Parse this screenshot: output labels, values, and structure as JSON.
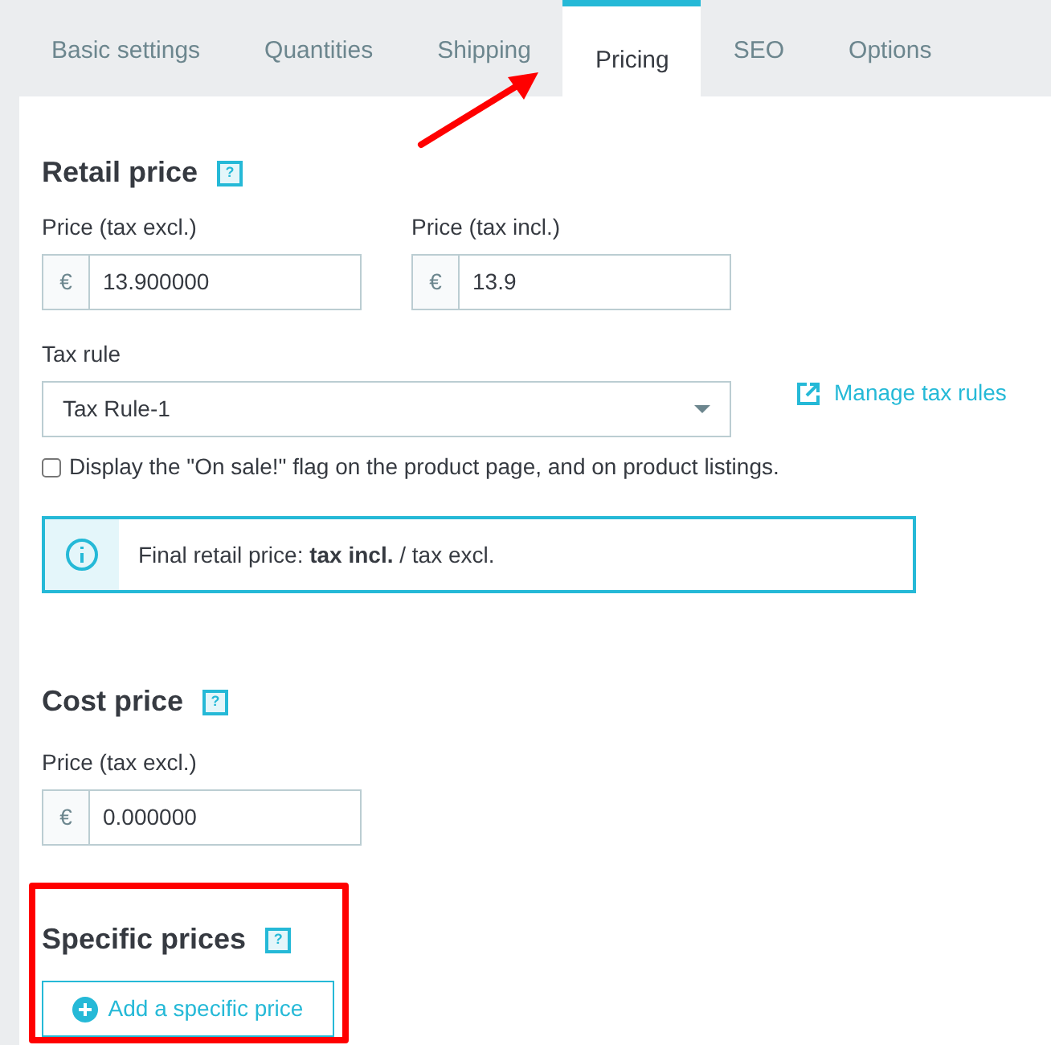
{
  "tabs": [
    {
      "label": "Basic settings",
      "selected": false
    },
    {
      "label": "Quantities",
      "selected": false
    },
    {
      "label": "Shipping",
      "selected": false
    },
    {
      "label": "Pricing",
      "selected": true
    },
    {
      "label": "SEO",
      "selected": false
    },
    {
      "label": "Options",
      "selected": false
    }
  ],
  "retail_price": {
    "title": "Retail price",
    "help": "?",
    "fields": [
      {
        "label": "Price (tax excl.)",
        "currency": "€",
        "value": "13.900000"
      },
      {
        "label": "Price (tax incl.)",
        "currency": "€",
        "value": "13.9"
      }
    ],
    "tax_rule": {
      "label": "Tax rule",
      "value": "Tax Rule-1"
    },
    "manage_link": "Manage tax rules",
    "on_sale": {
      "label": "Display the \"On sale!\" flag on the product page, and on product listings.",
      "checked": false
    },
    "info": "Final retail price: **tax incl.** / tax excl."
  },
  "cost_price": {
    "title": "Cost price",
    "help": "?",
    "field": {
      "label": "Price (tax excl.)",
      "currency": "€",
      "value": "0.000000"
    }
  },
  "specific_prices": {
    "title": "Specific prices",
    "help": "?",
    "button": "Add a specific price"
  }
}
